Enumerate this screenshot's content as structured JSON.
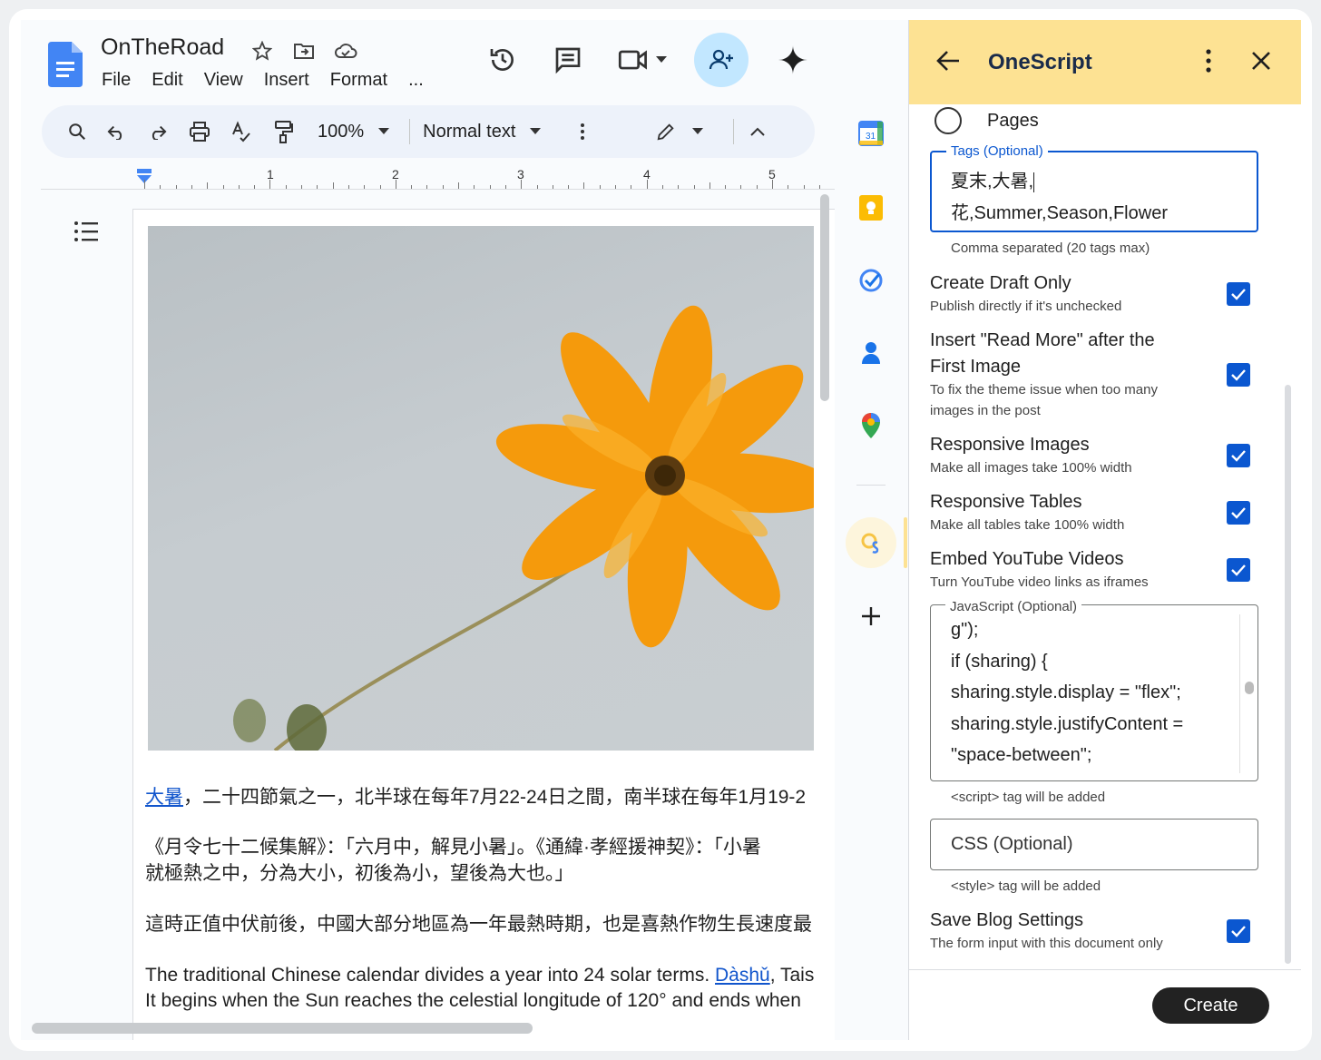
{
  "docs": {
    "title": "OnTheRoad",
    "menu": [
      "File",
      "Edit",
      "View",
      "Insert",
      "Format",
      "..."
    ],
    "toolbar": {
      "zoom": "100%",
      "style": "Normal text"
    },
    "ruler": [
      "1",
      "2",
      "3",
      "4",
      "5"
    ],
    "paragraphs": {
      "p1_link": "大暑",
      "p1_rest": "，二十四節氣之一，北半球在每年7月22-24日之間，南半球在每年1月19-2",
      "p2_line1": "《月令七十二候集解》：「六月中，解見小暑」。《通緯·孝經援神契》：「小暑",
      "p2_line2": "就極熱之中，分為大小，初後為小，望後為大也。」",
      "p3": "這時正值中伏前後，中國大部分地區為一年最熱時期，也是喜熱作物生長速度最",
      "p4_pre": "The traditional Chinese calendar divides a year into 24 solar terms. ",
      "p4_link": "Dàshǔ",
      "p4_post": ", Tais",
      "p4_line2": "It begins when the Sun reaches the celestial longitude of 120° and ends when"
    }
  },
  "panel": {
    "title": "OneScript",
    "pages_label": "Pages",
    "tags": {
      "legend": "Tags (Optional)",
      "line1": "夏末,大暑,",
      "line2": "花,Summer,Season,Flower",
      "hint": "Comma separated (20 tags max)"
    },
    "options": [
      {
        "label": "Create Draft Only",
        "sub": "Publish directly if it's unchecked"
      },
      {
        "label_line1": "Insert \"Read More\" after the",
        "label_line2": "First Image",
        "sub_line1": "To fix the theme issue when too many",
        "sub_line2": "images in the post"
      },
      {
        "label": "Responsive Images",
        "sub": "Make all images take 100% width"
      },
      {
        "label": "Responsive Tables",
        "sub": "Make all tables take 100% width"
      },
      {
        "label": "Embed YouTube Videos",
        "sub": "Turn YouTube video links as iframes"
      }
    ],
    "js": {
      "legend": "JavaScript (Optional)",
      "lines": [
        "g\");",
        "if (sharing) {",
        "sharing.style.display = \"flex\";",
        "sharing.style.justifyContent =",
        "\"space-between\";"
      ],
      "hint": "<script> tag will be added"
    },
    "css": {
      "placeholder": "CSS (Optional)",
      "hint": "<style> tag will be added"
    },
    "save": {
      "label": "Save Blog Settings",
      "sub": "The form input with this document only"
    },
    "create_label": "Create"
  }
}
